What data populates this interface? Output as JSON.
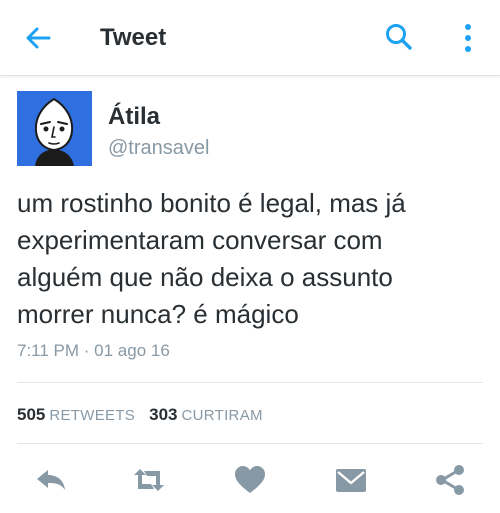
{
  "header": {
    "title": "Tweet",
    "back_icon": "arrow-left-icon",
    "search_icon": "search-icon",
    "more_icon": "more-vertical-icon"
  },
  "author": {
    "display_name": "Átila",
    "handle": "@transavel"
  },
  "tweet": {
    "lines": [
      "um rostinho bonito é legal, mas já",
      "experimentaram conversar com",
      "alguém que não deixa o assunto",
      "morrer nunca? é mágico"
    ],
    "timestamp": "7:11 PM · 01 ago 16"
  },
  "stats": {
    "retweets_count": "505",
    "retweets_label": "RETWEETS",
    "likes_count": "303",
    "likes_label": "CURTIRAM"
  },
  "actions": [
    "reply-icon",
    "retweet-icon",
    "heart-icon",
    "mail-icon",
    "share-icon"
  ],
  "colors": {
    "accent": "#1da1f2",
    "text": "#292f33",
    "muted": "#8899a6",
    "icon_gray": "#8899a6",
    "avatar_bg": "#2f6fe0"
  }
}
